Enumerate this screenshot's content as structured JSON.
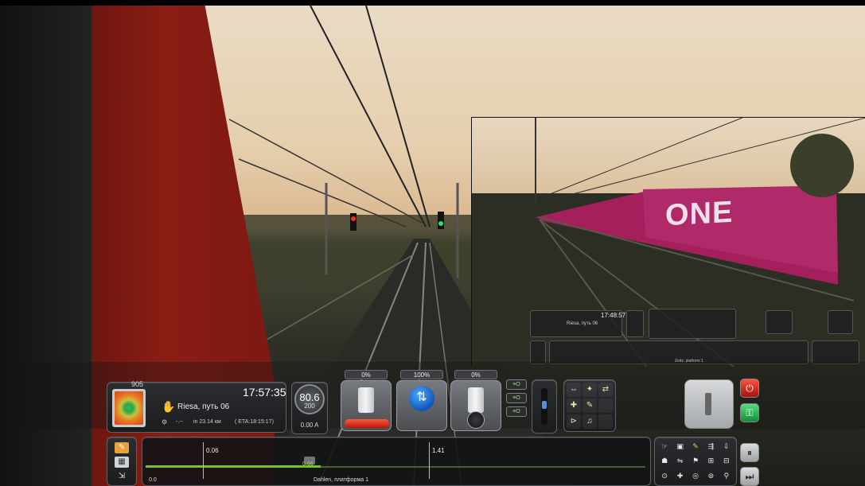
{
  "scene": {
    "pip": {
      "container_text": "ONE",
      "time": "17:48:57",
      "location": "Riesa, путь 06",
      "track_station": "Zeitz, platform 1"
    }
  },
  "hud": {
    "info": {
      "signal_id": "905",
      "next_station": "Riesa, путь 06",
      "clock": "17:57:35",
      "dashes": "-.--",
      "distance": "in 23.14 км",
      "eta": "( ETA:18:15:17)"
    },
    "speed": {
      "value": "80.6",
      "limit": "200",
      "amps": "0.00 A"
    },
    "levers": {
      "throttle_pct": "0%",
      "reverser_pct": "100%",
      "brake_pct": "0%",
      "reverser_icon": "⇅"
    },
    "small_buttons": [
      "≡O",
      "≡O",
      "≡O"
    ],
    "function_grid": [
      "⇔",
      "✦",
      "⇄",
      "✚",
      "✎",
      "",
      "⊳",
      "♫",
      ""
    ],
    "stop_icon": "⏻",
    "key_icon": "⚿"
  },
  "trackbar": {
    "start": "0.0",
    "marker_1": "0.06",
    "marker_2": "1.41",
    "current": "0.66",
    "station": "Dahlen, платформа 1",
    "signal_colors": [
      "#d43a2a",
      "#d43a2a"
    ]
  },
  "camera_grid": [
    "☞",
    "▣",
    "✎",
    "⇶",
    "⇩",
    "☗",
    "⇋",
    "⚑",
    "⊞",
    "⊟",
    "⊙",
    "✚",
    "◎",
    "⊚",
    "⚲"
  ],
  "pause_icon": "⏸",
  "next_icon": "⏭",
  "map_icons": [
    "✎",
    "▦",
    "⇲"
  ]
}
